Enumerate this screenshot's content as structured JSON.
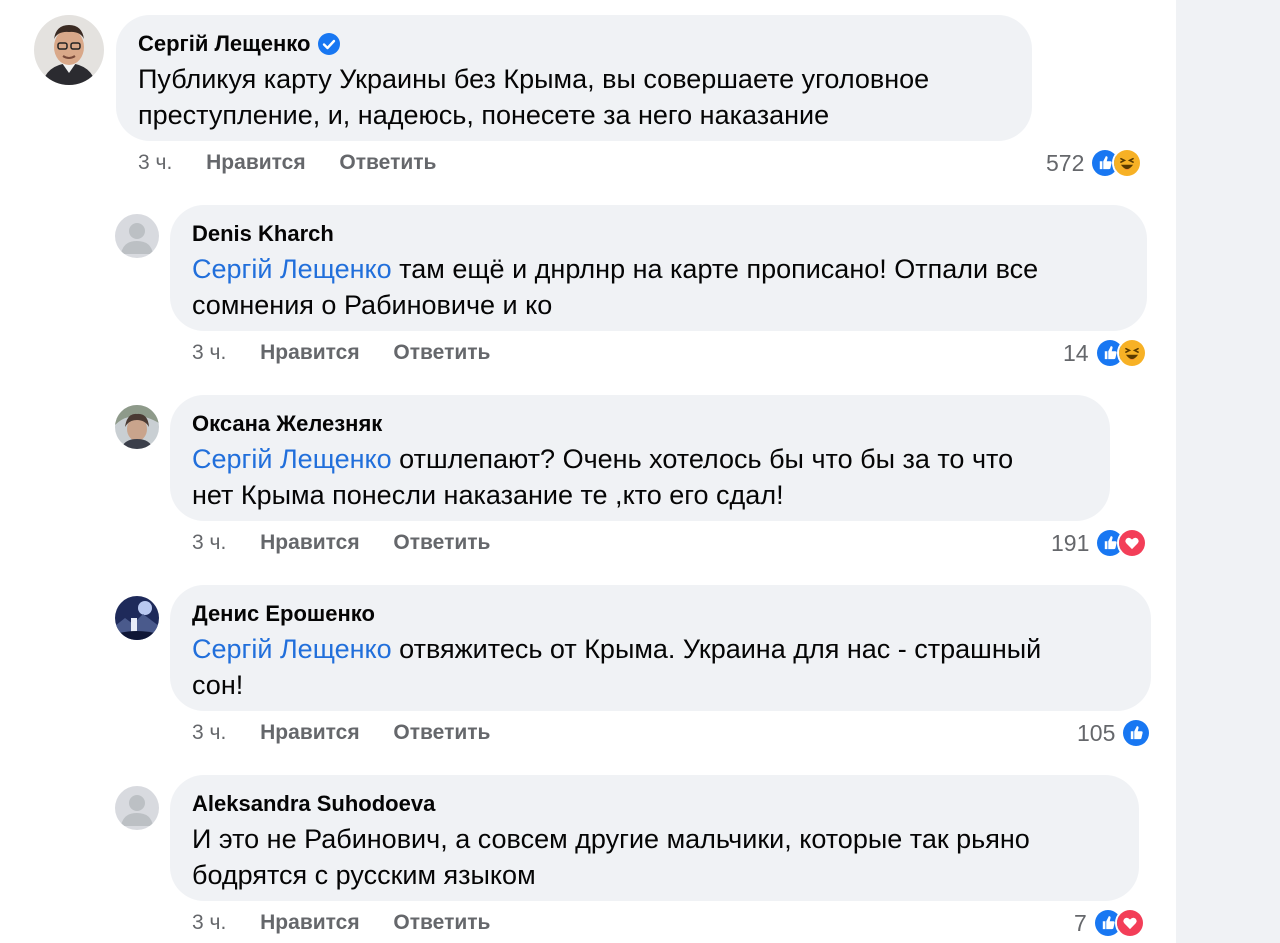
{
  "comments": [
    {
      "author": "Сергій Лещенко",
      "verified": true,
      "line1": "Публикуя карту Украины без Крыма, вы совершаете уголовное",
      "line2": "преступление, и, надеюсь, понесете за него наказание",
      "mention": "",
      "time": "3 ч.",
      "like": "Нравится",
      "reply": "Ответить",
      "count": "572",
      "reactions": [
        "like-icon",
        "haha-icon"
      ]
    },
    {
      "author": "Denis Kharch",
      "mention": "Сергій Лещенко",
      "line1": " там ещё и днрлнр на карте прописано! Отпали все",
      "line2": "сомнения о Рабиновиче и ко",
      "time": "3 ч.",
      "like": "Нравится",
      "reply": "Ответить",
      "count": "14",
      "reactions": [
        "like-icon",
        "haha-icon"
      ]
    },
    {
      "author": "Оксана Железняк",
      "mention": "Сергій Лещенко",
      "line1": " отшлепают? Очень хотелось бы что бы за то что",
      "line2": "нет Крыма понесли наказание те ,кто его сдал!",
      "time": "3 ч.",
      "like": "Нравится",
      "reply": "Ответить",
      "count": "191",
      "reactions": [
        "like-icon",
        "love-icon"
      ]
    },
    {
      "author": "Денис Ерошенко",
      "mention": "Сергій Лещенко",
      "line1": " отвяжитесь от Крыма. Украина для нас - страшный",
      "line2": "сон!",
      "time": "3 ч.",
      "like": "Нравится",
      "reply": "Ответить",
      "count": "105",
      "reactions": [
        "like-icon"
      ]
    },
    {
      "author": "Aleksandra Suhodoeva",
      "mention": "",
      "line1": "И это не Рабинович, а совсем другие мальчики, которые так рьяно",
      "line2": "бодрятся с русским языком",
      "time": "3 ч.",
      "like": "Нравится",
      "reply": "Ответить",
      "count": "7",
      "reactions": [
        "like-icon",
        "love-icon"
      ]
    }
  ],
  "colors": {
    "bubble": "#f0f2f5",
    "mention": "#216fdb",
    "like": "#1877f2",
    "love": "#f33e58",
    "haha": "#f7b125",
    "meta": "#65676b"
  }
}
